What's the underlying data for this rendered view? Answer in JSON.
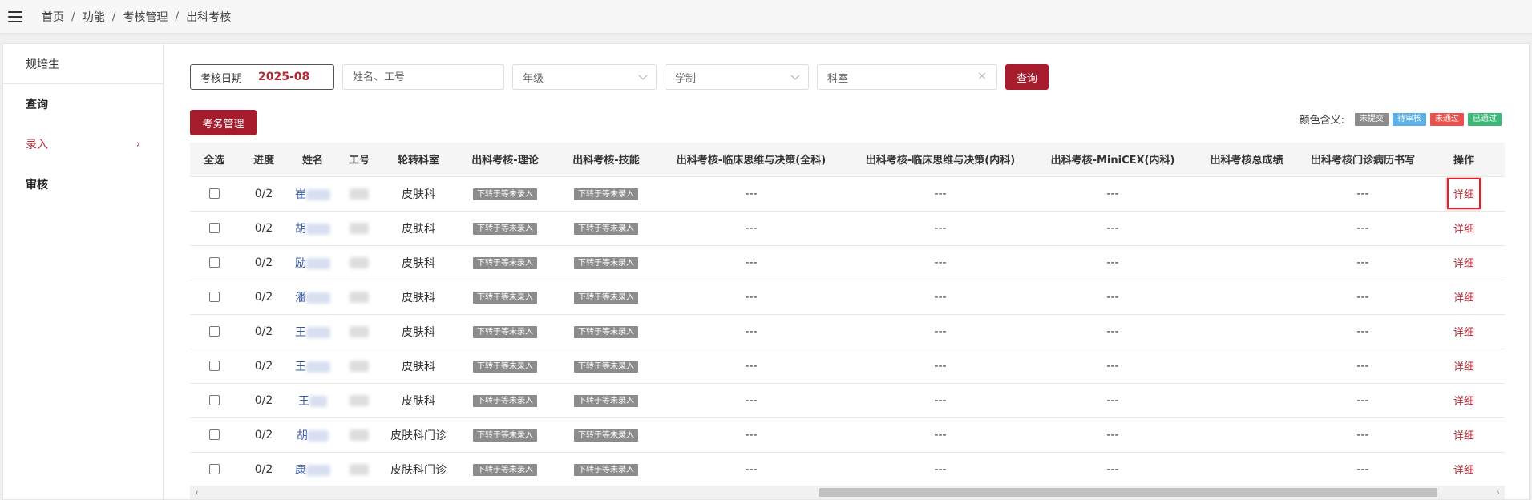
{
  "breadcrumb": [
    "首页",
    "功能",
    "考核管理",
    "出科考核"
  ],
  "breadcrumb_sep": "/",
  "sidebar": {
    "header": "规培生",
    "items": [
      {
        "label": "查询",
        "active": false
      },
      {
        "label": "录入",
        "active": true,
        "chevron": "›"
      },
      {
        "label": "审核",
        "active": false
      }
    ]
  },
  "filters": {
    "date_label": "考核日期",
    "date_value": "2025-08",
    "name_placeholder": "姓名、工号",
    "grade_placeholder": "年级",
    "schooling_placeholder": "学制",
    "dept_value": "科室",
    "clear_icon": "×",
    "query_label": "查询"
  },
  "toolbar": {
    "manage_label": "考务管理"
  },
  "legend": {
    "label": "颜色含义:",
    "items": [
      {
        "label": "未提交",
        "color": "#8c8c8c"
      },
      {
        "label": "待审核",
        "color": "#5bb0e6"
      },
      {
        "label": "未通过",
        "color": "#e9514a"
      },
      {
        "label": "已通过",
        "color": "#3cb979"
      }
    ]
  },
  "table": {
    "headers": [
      "全选",
      "进度",
      "姓名",
      "工号",
      "轮转科室",
      "出科考核-理论",
      "出科考核-技能",
      "出科考核-临床思维与决策(全科)",
      "出科考核-临床思维与决策(内科)",
      "出科考核-MiniCEX(内科)",
      "出科考核总成绩",
      "出科考核门诊病历书写",
      "操作"
    ],
    "status_tag": "下转于等未录入",
    "empty": "---",
    "action_label": "详细",
    "rows": [
      {
        "progress": "0/2",
        "name": "崔",
        "dept": "皮肤科"
      },
      {
        "progress": "0/2",
        "name": "胡",
        "dept": "皮肤科"
      },
      {
        "progress": "0/2",
        "name": "励",
        "dept": "皮肤科"
      },
      {
        "progress": "0/2",
        "name": "潘",
        "dept": "皮肤科"
      },
      {
        "progress": "0/2",
        "name": "王",
        "dept": "皮肤科"
      },
      {
        "progress": "0/2",
        "name": "王",
        "dept": "皮肤科"
      },
      {
        "progress": "0/2",
        "name": "王",
        "dept": "皮肤科"
      },
      {
        "progress": "0/2",
        "name": "胡",
        "dept": "皮肤科门诊"
      },
      {
        "progress": "0/2",
        "name": "康",
        "dept": "皮肤科门诊"
      }
    ]
  },
  "scrollbar": {
    "left_arrow": "‹",
    "right_arrow": "›"
  }
}
